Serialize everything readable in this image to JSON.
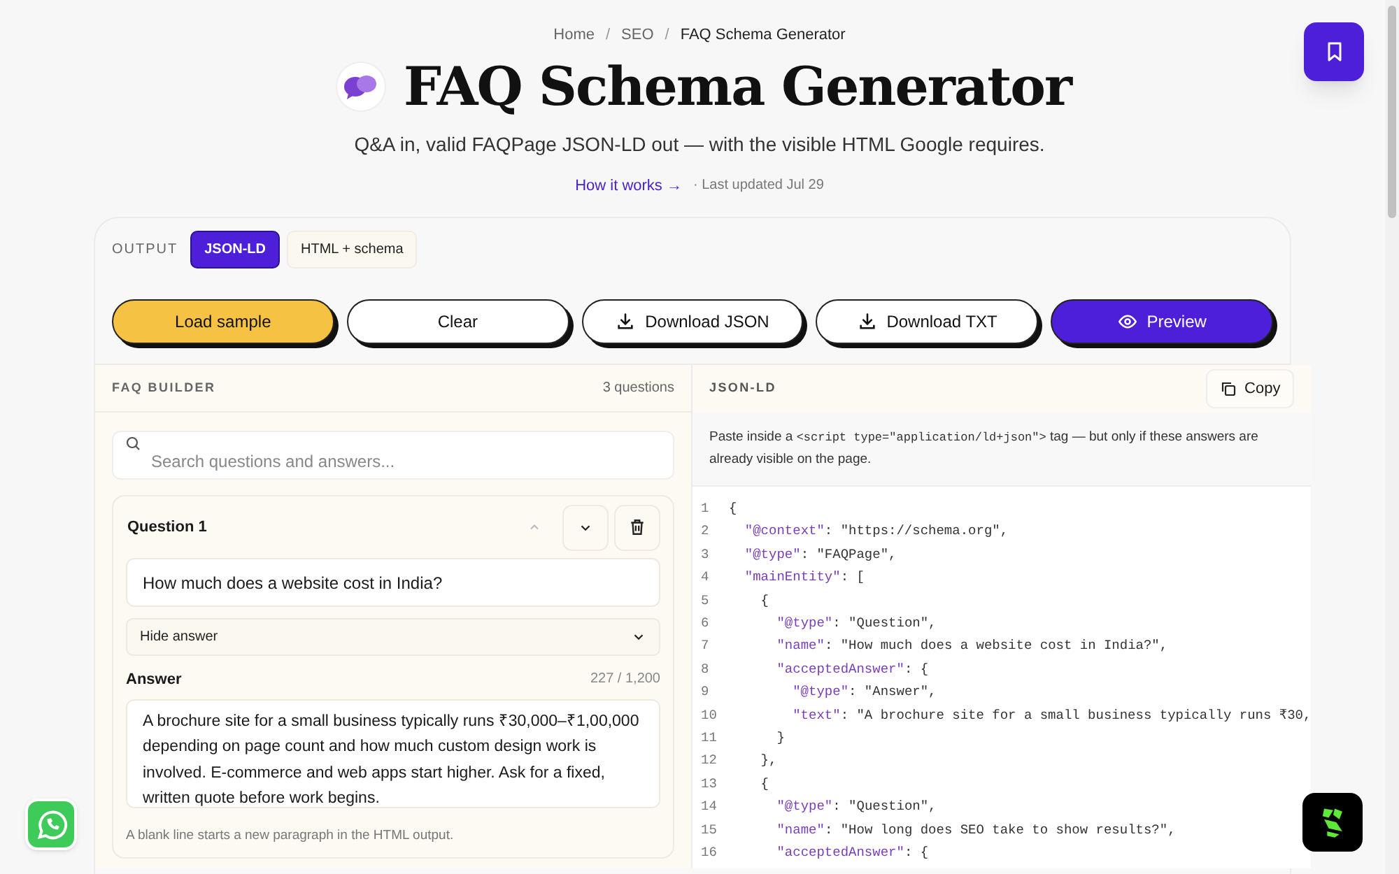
{
  "breadcrumbs": [
    {
      "label": "Home",
      "current": false
    },
    {
      "separator": "/",
      "label": "SEO",
      "current": false
    },
    {
      "separator": "/",
      "label": "FAQ Schema Generator",
      "current": true
    }
  ],
  "title": "FAQ Schema Generator",
  "subtitle": "Q&A in, valid FAQPage JSON-LD out — with the visible HTML Google requires.",
  "how_it_works": "How it works →",
  "last_updated": "· Last updated Jul 29",
  "output": {
    "label": "OUTPUT",
    "tabs": [
      {
        "label": "JSON-LD",
        "selected": true
      },
      {
        "label": "HTML + schema",
        "selected": false
      }
    ]
  },
  "actions": [
    {
      "label": "Load sample",
      "kind": "sample"
    },
    {
      "label": "Clear",
      "kind": "plain"
    },
    {
      "label": "Download JSON",
      "kind": "download"
    },
    {
      "label": "Download TXT",
      "kind": "download"
    },
    {
      "label": "Preview",
      "kind": "preview"
    }
  ],
  "builder": {
    "title": "FAQ BUILDER",
    "count": "3 questions",
    "search_placeholder": "Search questions and answers...",
    "questions": [
      {
        "label": "Question 1",
        "question": "How much does a website cost in India?",
        "expanded": true,
        "toggle": "Hide answer",
        "answer_label": "Answer",
        "counter": "227 / 1,200",
        "answer": "A brochure site for a small business typically runs ₹30,000–₹1,00,000 depending on page count and how much custom design work is involved. E-commerce and web apps start higher. Ask for a fixed, written quote before work begins.",
        "hint": "A blank line starts a new paragraph in the HTML output."
      }
    ]
  },
  "json_panel": {
    "title": "JSON-LD",
    "copy": "Copy",
    "note_before": "Paste inside a ",
    "note_code": "<script type=\"application/ld+json\">",
    "note_after": " tag — but only if these answers are already visible on the page.",
    "line_numbers": [
      "1",
      "2",
      "3",
      "4",
      "5",
      "6",
      "7",
      "8",
      "9",
      "10",
      "11",
      "12",
      "13",
      "14",
      "15",
      "16"
    ],
    "lines": [
      "{",
      "  \"@context\": \"https://schema.org\",",
      "  \"@type\": \"FAQPage\",",
      "  \"mainEntity\": [",
      "    {",
      "      \"@type\": \"Question\",",
      "      \"name\": \"How much does a website cost in India?\",",
      "      \"acceptedAnswer\": {",
      "        \"@type\": \"Answer\",",
      "        \"text\": \"A brochure site for a small business typically runs ₹30,",
      "      }",
      "    },",
      "    {",
      "      \"@type\": \"Question\",",
      "      \"name\": \"How long does SEO take to show results?\",",
      "      \"acceptedAnswer\": {"
    ]
  }
}
